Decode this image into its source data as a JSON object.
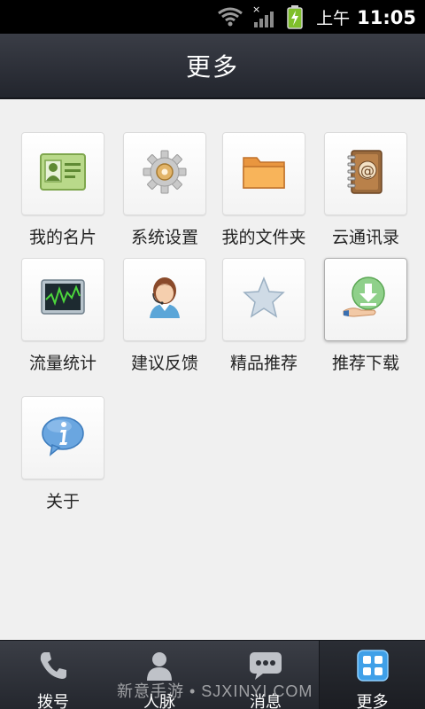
{
  "status_bar": {
    "ampm": "上午",
    "time": "11:05",
    "icons": [
      "wifi-icon",
      "signal-icon",
      "battery-charging-icon"
    ]
  },
  "header": {
    "title": "更多"
  },
  "grid": {
    "items": [
      {
        "label": "我的名片",
        "icon": "business-card-icon"
      },
      {
        "label": "系统设置",
        "icon": "gear-icon"
      },
      {
        "label": "我的文件夹",
        "icon": "folder-icon"
      },
      {
        "label": "云通讯录",
        "icon": "address-book-icon"
      },
      {
        "label": "流量统计",
        "icon": "traffic-chart-icon"
      },
      {
        "label": "建议反馈",
        "icon": "support-agent-icon"
      },
      {
        "label": "精品推荐",
        "icon": "star-icon"
      },
      {
        "label": "推荐下载",
        "icon": "download-icon"
      },
      {
        "label": "关于",
        "icon": "info-icon"
      }
    ]
  },
  "tab_bar": {
    "tabs": [
      {
        "label": "拨号",
        "icon": "phone-icon"
      },
      {
        "label": "人脉",
        "icon": "contacts-icon"
      },
      {
        "label": "消息",
        "icon": "message-icon"
      },
      {
        "label": "更多",
        "icon": "more-grid-icon"
      }
    ],
    "active_index": 3
  },
  "watermark": "新意手游 • SJXINYI.COM"
}
